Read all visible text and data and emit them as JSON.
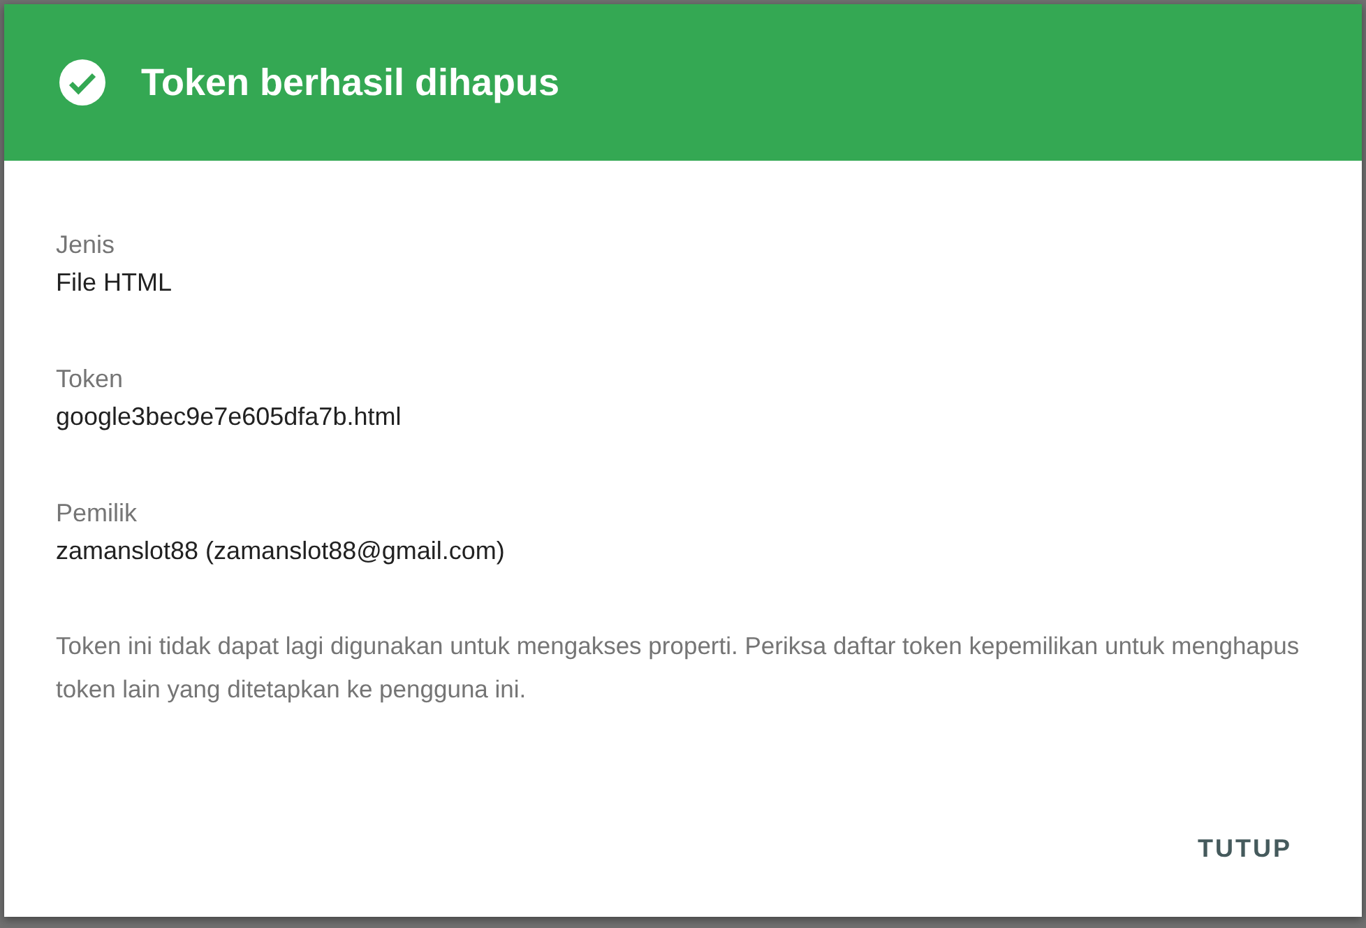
{
  "dialog": {
    "title": "Token berhasil dihapus",
    "fields": [
      {
        "label": "Jenis",
        "value": "File HTML"
      },
      {
        "label": "Token",
        "value": "google3bec9e7e605dfa7b.html"
      },
      {
        "label": "Pemilik",
        "value": "zamanslot88 (zamanslot88@gmail.com)"
      }
    ],
    "message": "Token ini tidak dapat lagi digunakan untuk mengakses properti. Periksa daftar token kepemilikan untuk menghapus token lain yang ditetapkan ke pengguna ini.",
    "buttons": [
      "TUTUP"
    ]
  }
}
